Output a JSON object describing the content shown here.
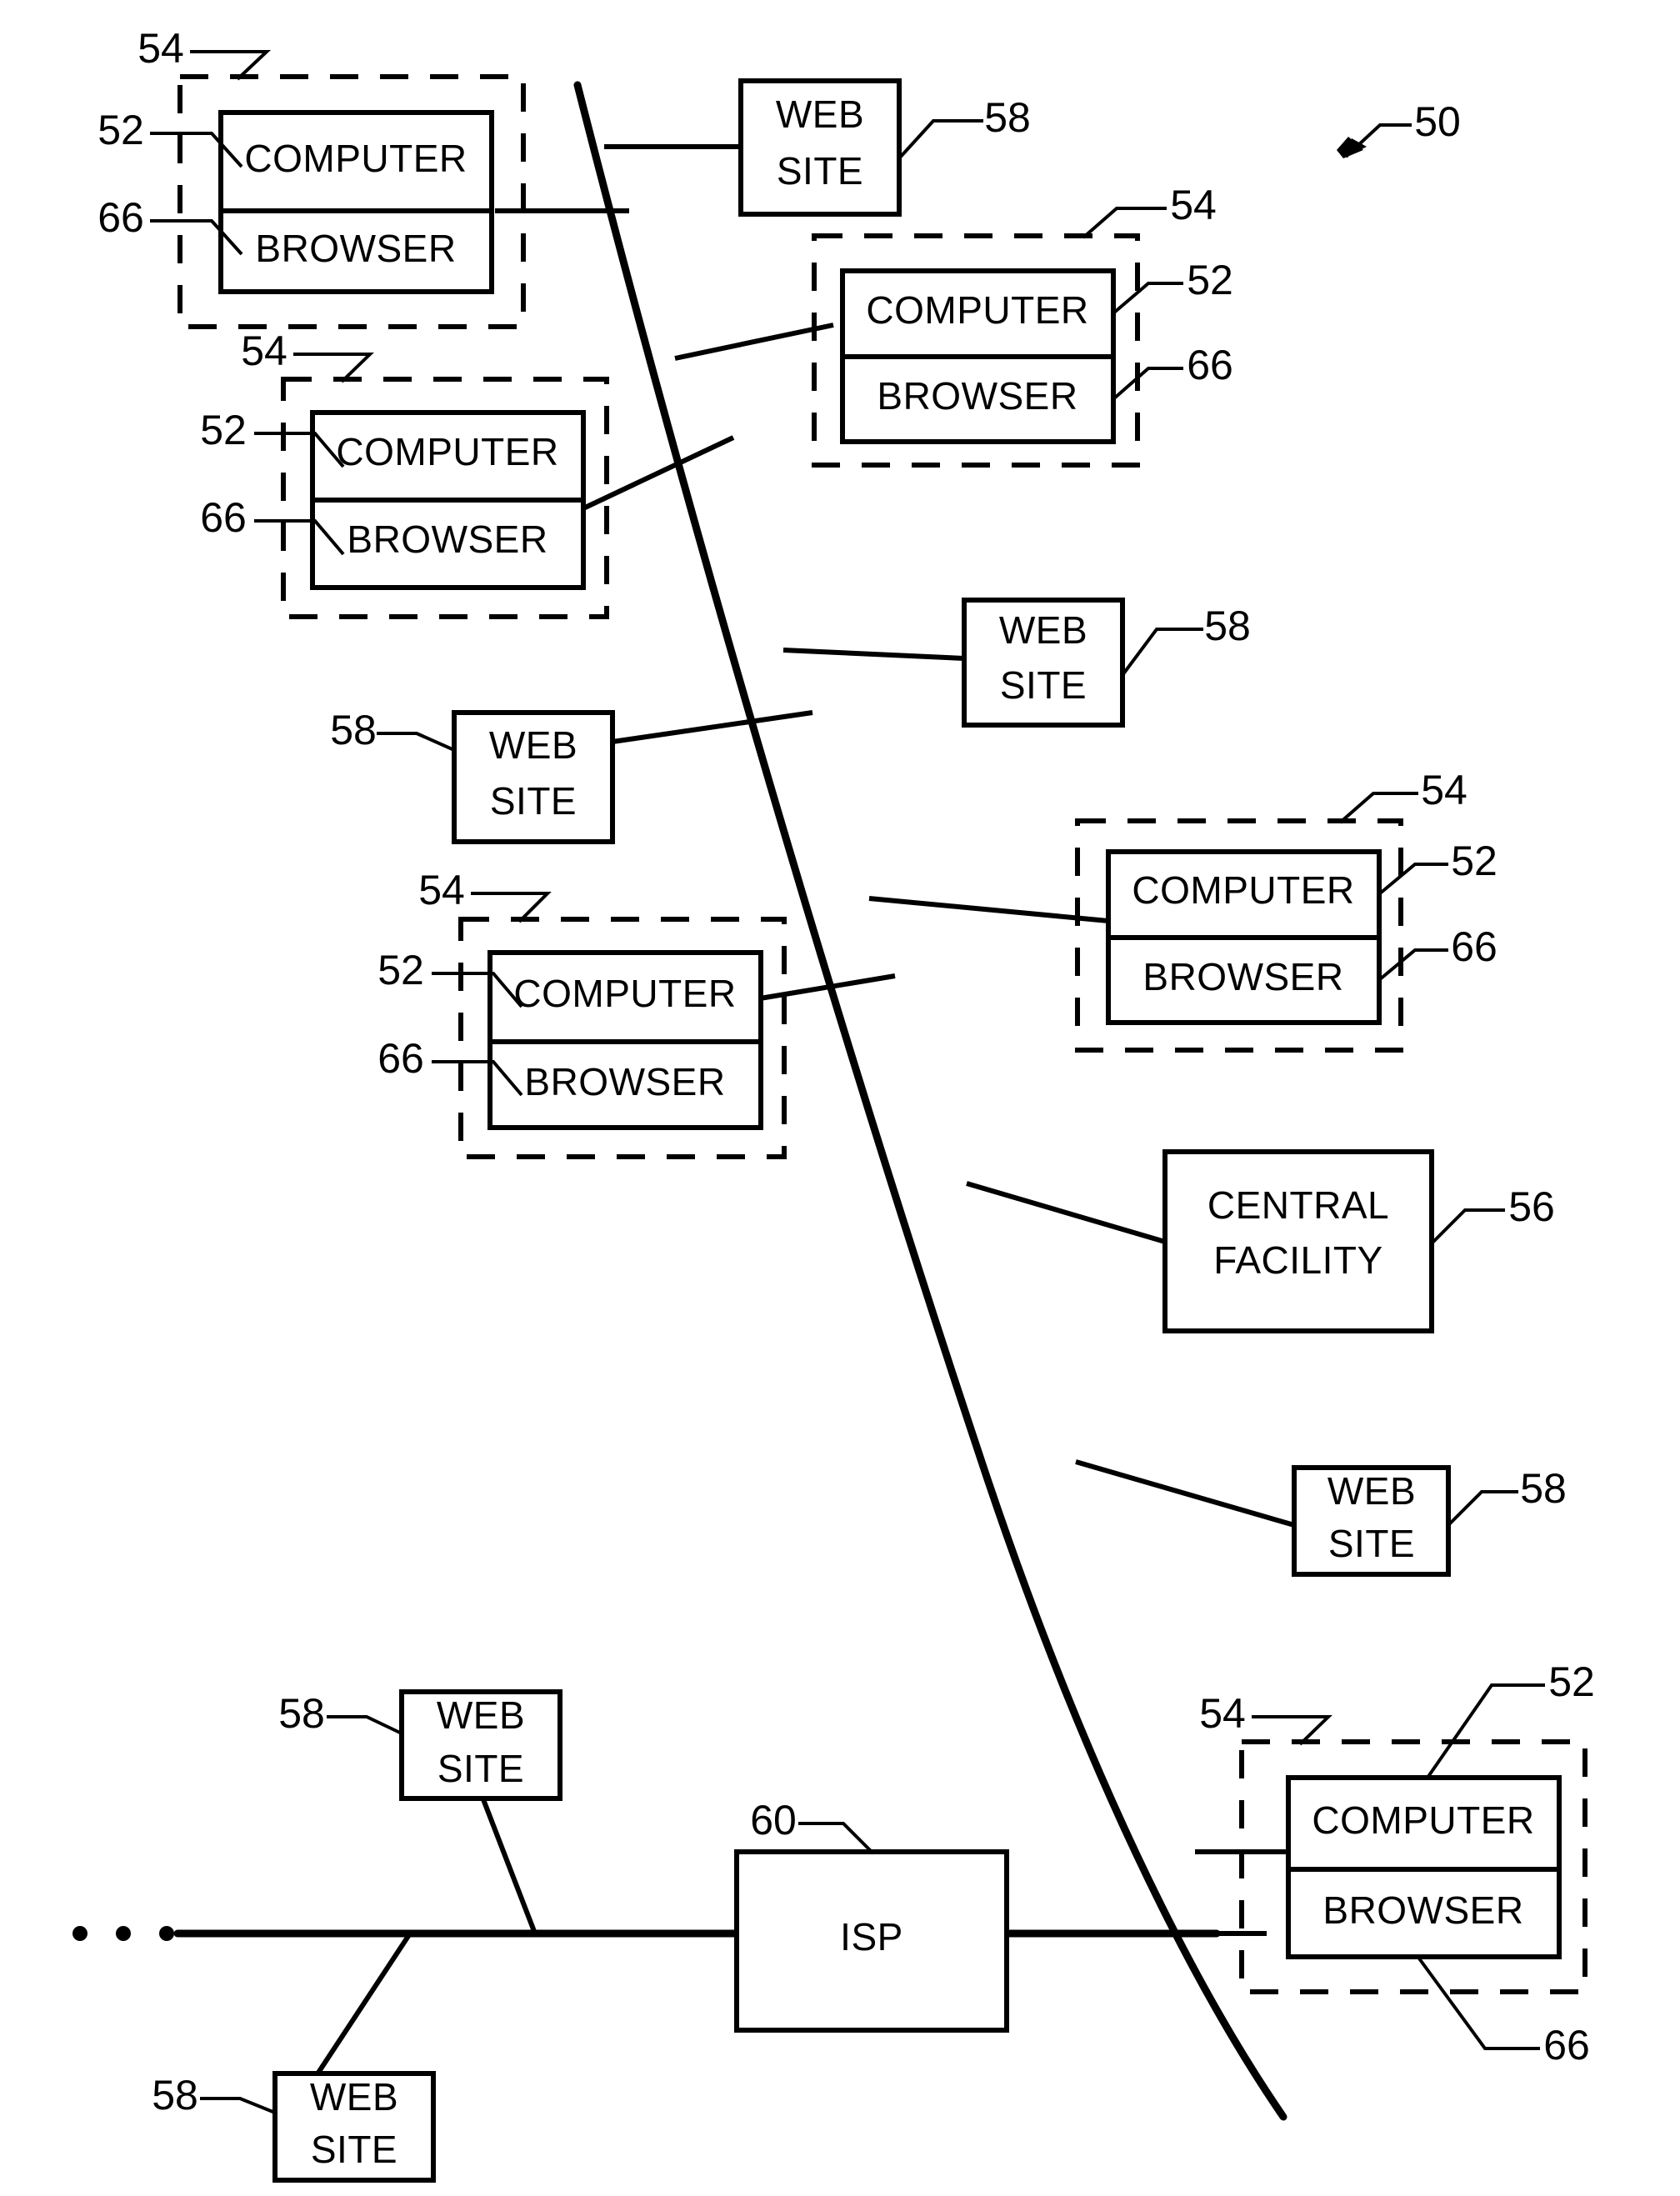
{
  "figure": {
    "title": "Network system block diagram",
    "figure_reference": "50",
    "ink_color": "#000000",
    "background_color": "#ffffff"
  },
  "reference_numerals": {
    "system": "50",
    "computer": "52",
    "user_station": "54",
    "central_facility": "56",
    "web_site": "58",
    "isp": "60",
    "browser": "66"
  },
  "labels": {
    "computer": "COMPUTER",
    "browser": "BROWSER",
    "web_site_line1": "WEB",
    "web_site_line2": "SITE",
    "central_facility_line1": "CENTRAL",
    "central_facility_line2": "FACILITY",
    "isp": "ISP"
  },
  "nodes": {
    "user_stations": [
      {
        "id": "user-station-1",
        "computer_label": "COMPUTER",
        "browser_label": "BROWSER",
        "ref_station": "54",
        "ref_computer": "52",
        "ref_browser": "66"
      },
      {
        "id": "user-station-2",
        "computer_label": "COMPUTER",
        "browser_label": "BROWSER",
        "ref_station": "54",
        "ref_computer": "52",
        "ref_browser": "66"
      },
      {
        "id": "user-station-3",
        "computer_label": "COMPUTER",
        "browser_label": "BROWSER",
        "ref_station": "54",
        "ref_computer": "52",
        "ref_browser": "66"
      },
      {
        "id": "user-station-4",
        "computer_label": "COMPUTER",
        "browser_label": "BROWSER",
        "ref_station": "54",
        "ref_computer": "52",
        "ref_browser": "66"
      },
      {
        "id": "user-station-5",
        "computer_label": "COMPUTER",
        "browser_label": "BROWSER",
        "ref_station": "54",
        "ref_computer": "52",
        "ref_browser": "66"
      },
      {
        "id": "user-station-6",
        "computer_label": "COMPUTER",
        "browser_label": "BROWSER",
        "ref_station": "54",
        "ref_computer": "52",
        "ref_browser": "66"
      }
    ],
    "web_sites": [
      {
        "id": "web-site-1",
        "line1": "WEB",
        "line2": "SITE",
        "ref": "58"
      },
      {
        "id": "web-site-2",
        "line1": "WEB",
        "line2": "SITE",
        "ref": "58"
      },
      {
        "id": "web-site-3",
        "line1": "WEB",
        "line2": "SITE",
        "ref": "58"
      },
      {
        "id": "web-site-4",
        "line1": "WEB",
        "line2": "SITE",
        "ref": "58"
      },
      {
        "id": "web-site-5",
        "line1": "WEB",
        "line2": "SITE",
        "ref": "58"
      },
      {
        "id": "web-site-6",
        "line1": "WEB",
        "line2": "SITE",
        "ref": "58"
      }
    ],
    "central_facility": {
      "id": "central-facility",
      "line1": "CENTRAL",
      "line2": "FACILITY",
      "ref": "56"
    },
    "isp": {
      "id": "isp",
      "label": "ISP",
      "ref": "60"
    }
  }
}
